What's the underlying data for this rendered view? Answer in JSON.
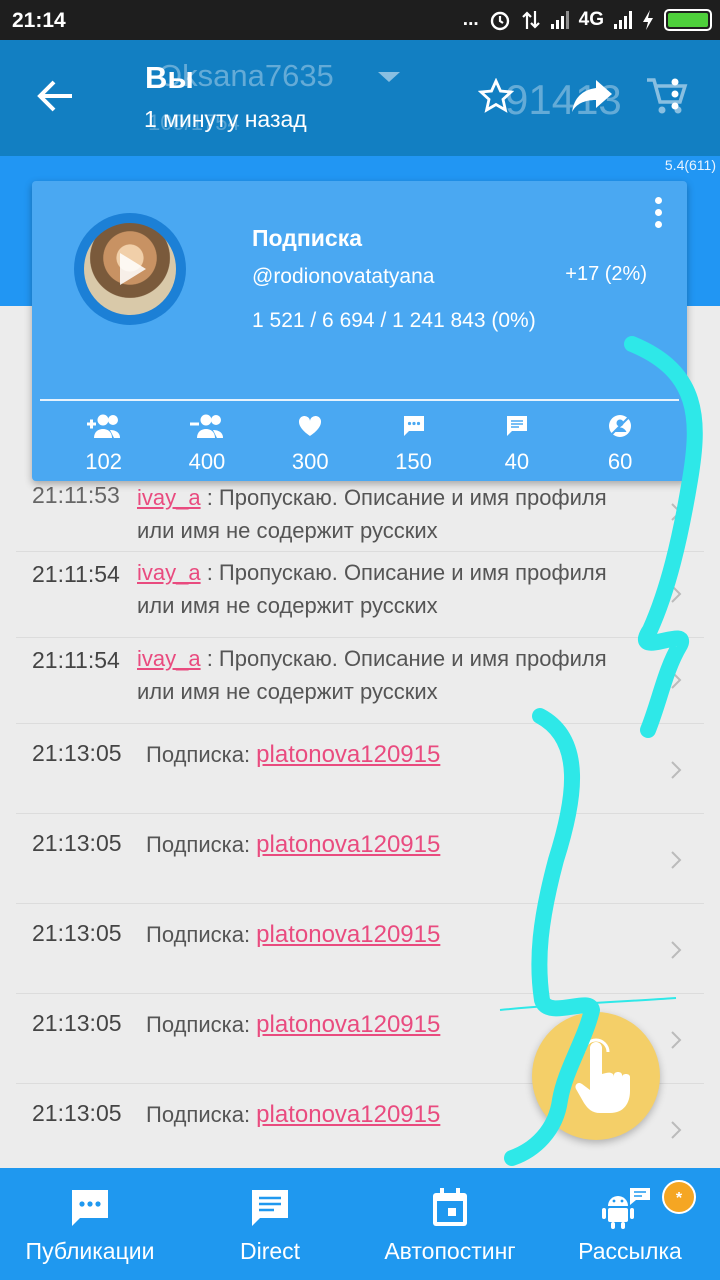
{
  "status_bar": {
    "time": "21:14",
    "dots": "...",
    "network": "4G"
  },
  "app_bar": {
    "title": "Вы",
    "subtitle": "1 минуту назад",
    "ghost_name": "Oksana7635",
    "ghost_sub": "100/1754",
    "ghost_count": "91413"
  },
  "version": "5.4(611)",
  "card": {
    "label": "Подписка",
    "username": "@rodionovatatyana",
    "delta": "+17 (2%)",
    "stats": "1 521 / 6 694 / 1 241 843 (0%)",
    "counters": [
      {
        "icon": "add-person-icon",
        "value": "102"
      },
      {
        "icon": "remove-person-icon",
        "value": "400"
      },
      {
        "icon": "heart-icon",
        "value": "300"
      },
      {
        "icon": "comment-icon",
        "value": "150"
      },
      {
        "icon": "message-icon",
        "value": "40"
      },
      {
        "icon": "unfollow-icon",
        "value": "60"
      }
    ]
  },
  "log": {
    "skip_rows": [
      {
        "time": "21:11:53",
        "user": "ivay_a",
        "text": " : Пропускаю. Описание и имя профиля или имя не содержит русских"
      },
      {
        "time": "21:11:54",
        "user": "ivay_a",
        "text": " : Пропускаю. Описание и имя профиля или имя не содержит русских"
      },
      {
        "time": "21:11:54",
        "user": "ivay_a",
        "text": " : Пропускаю. Описание и имя профиля или имя не содержит русских"
      }
    ],
    "follow_rows": [
      {
        "time": "21:13:05",
        "label": "Подписка: ",
        "user": "platonova120915"
      },
      {
        "time": "21:13:05",
        "label": "Подписка: ",
        "user": "platonova120915"
      },
      {
        "time": "21:13:05",
        "label": "Подписка: ",
        "user": "platonova120915"
      },
      {
        "time": "21:13:05",
        "label": "Подписка: ",
        "user": "platonova120915"
      },
      {
        "time": "21:13:05",
        "label": "Подписка: ",
        "user": "platonova120915"
      }
    ]
  },
  "bottom_nav": [
    {
      "label": "Публикации",
      "icon": "publications-icon"
    },
    {
      "label": "Direct",
      "icon": "direct-icon"
    },
    {
      "label": "Автопостинг",
      "icon": "calendar-icon"
    },
    {
      "label": "Рассылка",
      "icon": "android-icon",
      "badge": "*"
    }
  ],
  "colors": {
    "app_bar": "#127fc2",
    "card": "#4aa8f2",
    "accent_link": "#e94b7f",
    "bottom_nav": "#1f98ef",
    "fab": "#f4cf68",
    "annotation": "#2ee8e8"
  }
}
